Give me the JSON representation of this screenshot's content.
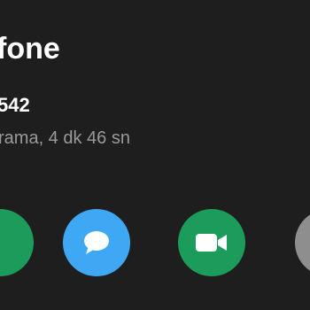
{
  "contact": {
    "name_partial": "fone",
    "number_partial": "542",
    "call_detail_partial": "rama, 4 dk 46 sn"
  },
  "actions": [
    {
      "icon": "call-icon",
      "color": "#1b9c5a"
    },
    {
      "icon": "message-icon",
      "color": "#3ea8f5"
    },
    {
      "icon": "video-call-icon",
      "color": "#1b9c5a"
    },
    {
      "icon": "more-icon",
      "color": "#8e8e8e"
    }
  ],
  "colors": {
    "background": "#1e1e1e",
    "primary_text": "#ffffff",
    "secondary_text": "#9a9a9a"
  }
}
